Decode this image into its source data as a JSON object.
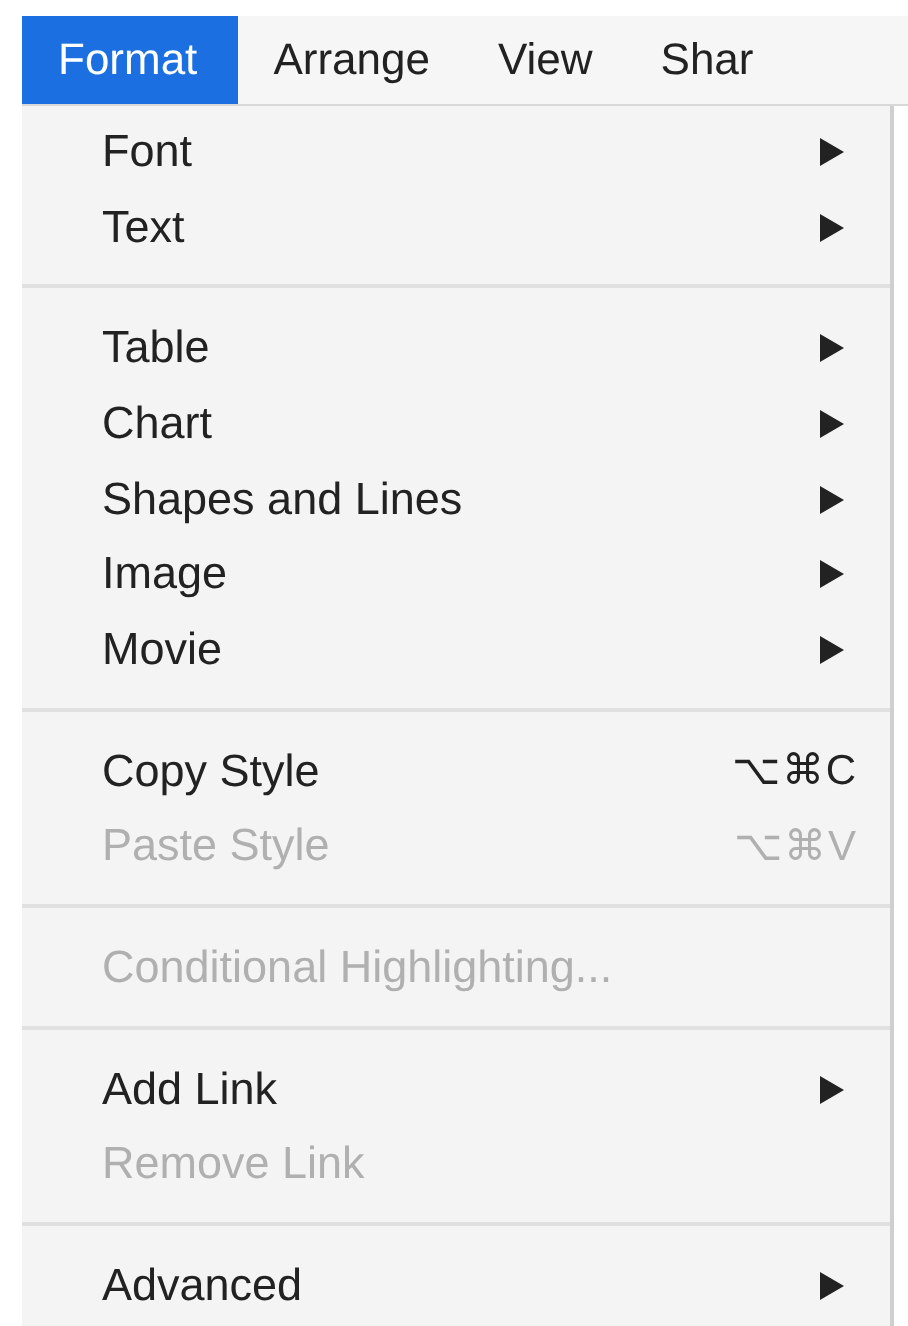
{
  "menu_bar": [
    {
      "label": "Format",
      "selected": true
    },
    {
      "label": "Arrange",
      "selected": false
    },
    {
      "label": "View",
      "selected": false
    },
    {
      "label": "Shar",
      "selected": false
    }
  ],
  "menu": {
    "groups": [
      {
        "items": [
          {
            "kind": "submenu",
            "label": "Font",
            "disabled": false
          },
          {
            "kind": "submenu",
            "label": "Text",
            "disabled": false
          }
        ]
      },
      {
        "items": [
          {
            "kind": "submenu",
            "label": "Table",
            "disabled": false
          },
          {
            "kind": "submenu",
            "label": "Chart",
            "disabled": false
          },
          {
            "kind": "submenu",
            "label": "Shapes and Lines",
            "disabled": false
          },
          {
            "kind": "submenu",
            "label": "Image",
            "disabled": false
          },
          {
            "kind": "submenu",
            "label": "Movie",
            "disabled": false
          }
        ]
      },
      {
        "items": [
          {
            "kind": "shortcut",
            "label": "Copy Style",
            "shortcut": "⌥⌘C",
            "disabled": false
          },
          {
            "kind": "shortcut",
            "label": "Paste Style",
            "shortcut": "⌥⌘V",
            "disabled": true
          }
        ]
      },
      {
        "items": [
          {
            "kind": "plain",
            "label": "Conditional Highlighting...",
            "disabled": true
          }
        ]
      },
      {
        "items": [
          {
            "kind": "submenu",
            "label": "Add Link",
            "disabled": false
          },
          {
            "kind": "plain",
            "label": "Remove Link",
            "disabled": true
          }
        ]
      },
      {
        "items": [
          {
            "kind": "submenu",
            "label": "Advanced",
            "disabled": false
          }
        ]
      }
    ]
  }
}
